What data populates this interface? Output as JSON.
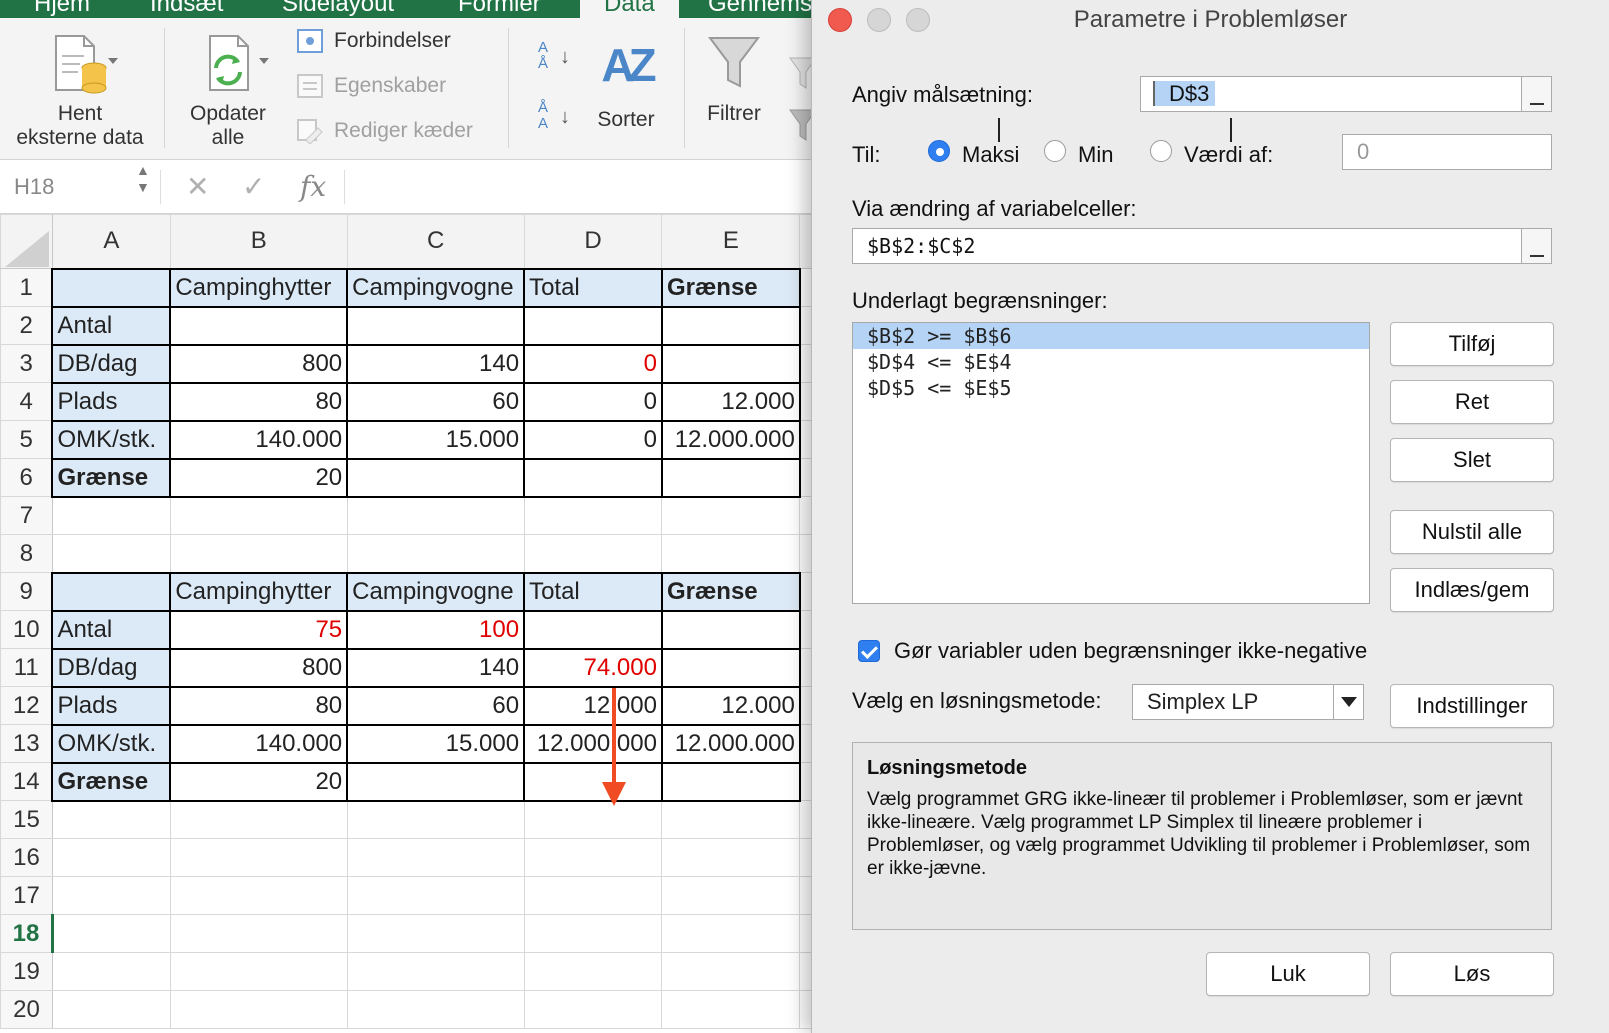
{
  "ribbon": {
    "tabs": [
      "Hjem",
      "Indsæt",
      "Sidelayout",
      "Formler",
      "Data",
      "Gennemse"
    ],
    "active_tab": "Data",
    "hent_label_1": "Hent",
    "hent_label_2": "eksterne data",
    "opdater_label_1": "Opdater",
    "opdater_label_2": "alle",
    "forbindelser": "Forbindelser",
    "egenskaber": "Egenskaber",
    "rediger": "Rediger kæder",
    "sorter": "Sorter",
    "filtrer": "Filtrer",
    "sort_az_top": "A",
    "sort_az_bottom": "Å",
    "sort_za_top": "Å",
    "sort_za_bottom": "A",
    "az_icon_text": "AZ"
  },
  "formula_bar": {
    "name_box": "H18",
    "cancel_glyph": "✕",
    "confirm_glyph": "✓",
    "fx": "fx"
  },
  "sheet": {
    "columns": [
      "A",
      "B",
      "C",
      "D",
      "E"
    ],
    "rows": [
      [
        "",
        "Campinghytter",
        "Campingvogne",
        "Total",
        "Grænse"
      ],
      [
        "Antal",
        "",
        "",
        "",
        ""
      ],
      [
        "DB/dag",
        "800",
        "140",
        "0",
        ""
      ],
      [
        "Plads",
        "80",
        "60",
        "0",
        "12.000"
      ],
      [
        "OMK/stk.",
        "140.000",
        "15.000",
        "0",
        "12.000.000"
      ],
      [
        "Grænse",
        "20",
        "",
        "",
        ""
      ],
      [
        "",
        "",
        "",
        "",
        ""
      ],
      [
        "",
        "",
        "",
        "",
        ""
      ],
      [
        "",
        "Campinghytter",
        "Campingvogne",
        "Total",
        "Grænse"
      ],
      [
        "Antal",
        "75",
        "100",
        "",
        ""
      ],
      [
        "DB/dag",
        "800",
        "140",
        "74.000",
        ""
      ],
      [
        "Plads",
        "80",
        "60",
        "12.000",
        "12.000"
      ],
      [
        "OMK/stk.",
        "140.000",
        "15.000",
        "12.000.000",
        "12.000.000"
      ],
      [
        "Grænse",
        "20",
        "",
        "",
        ""
      ],
      [
        "",
        "",
        "",
        "",
        ""
      ],
      [
        "",
        "",
        "",
        "",
        ""
      ],
      [
        "",
        "",
        "",
        "",
        ""
      ],
      [
        "",
        "",
        "",
        "",
        ""
      ],
      [
        "",
        "",
        "",
        "",
        ""
      ],
      [
        "",
        "",
        "",
        "",
        ""
      ]
    ],
    "selected_row": 18,
    "highlight_color": "#e00000",
    "header_fill": "#dce9f6"
  },
  "dialog": {
    "title": "Parametre i Problemløser",
    "objective_label": "Angiv målsætning:",
    "objective_value": "D$3",
    "to_label": "Til:",
    "opt_max": "Maksi",
    "opt_min": "Min",
    "opt_value": "Værdi af:",
    "value_of": "0",
    "selected_option": "Maksi",
    "variable_label": "Via ændring af variabelceller:",
    "variable_value": "$B$2:$C$2",
    "constraints_label": "Underlagt begrænsninger:",
    "constraints": [
      "$B$2 >= $B$6",
      "$D$4 <= $E$4",
      "$D$5 <= $E$5"
    ],
    "btn_add": "Tilføj",
    "btn_change": "Ret",
    "btn_delete": "Slet",
    "btn_reset": "Nulstil alle",
    "btn_load": "Indlæs/gem",
    "nonneg_label": "Gør variabler uden begrænsninger ikke-negative",
    "nonneg_checked": true,
    "method_label": "Vælg en løsningsmetode:",
    "method_value": "Simplex LP",
    "btn_options": "Indstillinger",
    "info_title": "Løsningsmetode",
    "info_text": "Vælg programmet GRG ikke-lineær til problemer i Problemløser, som er jævnt ikke-lineære. Vælg programmet LP Simplex til lineære problemer i Problemløser, og vælg programmet Udvikling til problemer i Problemløser, som er ikke-jævne.",
    "btn_close": "Luk",
    "btn_solve": "Løs",
    "accent_color": "#2f7ff0"
  }
}
